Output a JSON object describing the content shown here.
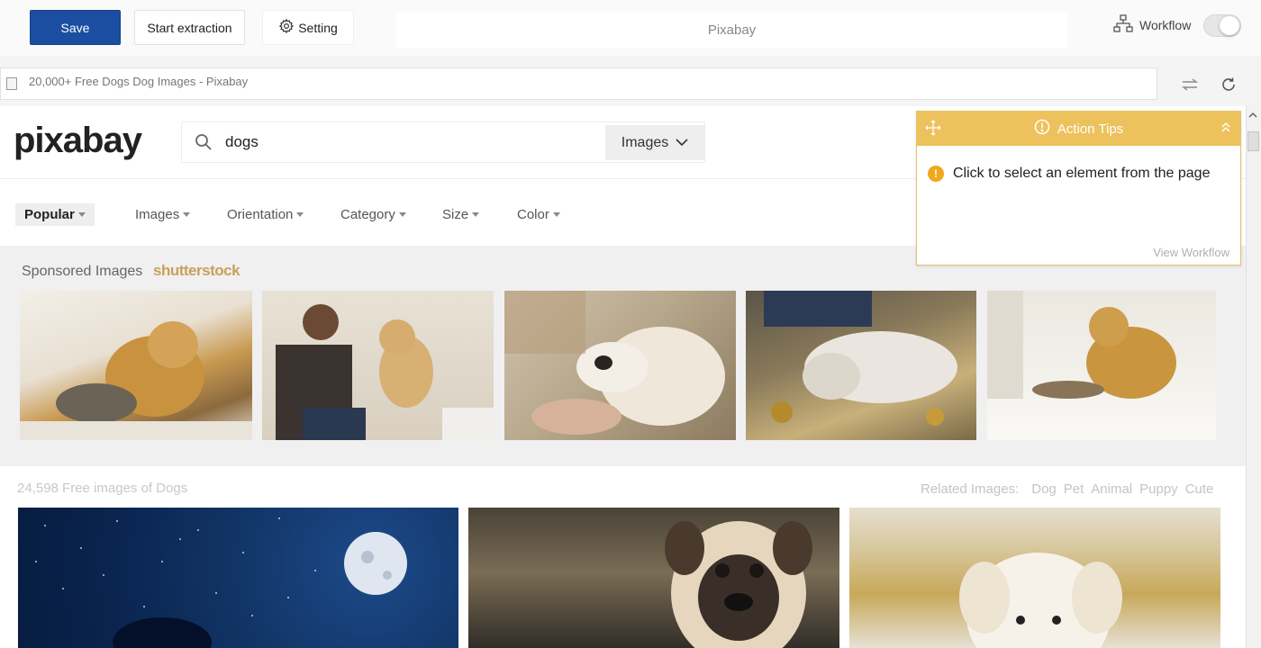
{
  "toolbar": {
    "save_label": "Save",
    "start_extraction_label": "Start extraction",
    "setting_label": "Setting",
    "page_title": "Pixabay",
    "workflow_label": "Workflow"
  },
  "addressbar": {
    "tab_title": "20,000+ Free Dogs  Dog Images - Pixabay"
  },
  "page": {
    "logo": "pixabay",
    "search": {
      "query": "dogs",
      "type": "Images"
    },
    "filters": [
      "Popular",
      "Images",
      "Orientation",
      "Category",
      "Size",
      "Color"
    ],
    "sponsored": {
      "label": "Sponsored Images",
      "brand": "shutterstock"
    },
    "results_count": "24,598 Free images of Dogs",
    "related": {
      "label": "Related Images:",
      "tags": [
        "Dog",
        "Pet",
        "Animal",
        "Puppy",
        "Cute"
      ]
    }
  },
  "action_tips": {
    "title": "Action Tips",
    "message": "Click to select an element from the page",
    "link": "View Workflow"
  },
  "colors": {
    "primary": "#1b4ea0",
    "tips_header": "#edc15c",
    "warning": "#f0a81d",
    "brand_gold": "#c9a05a"
  }
}
